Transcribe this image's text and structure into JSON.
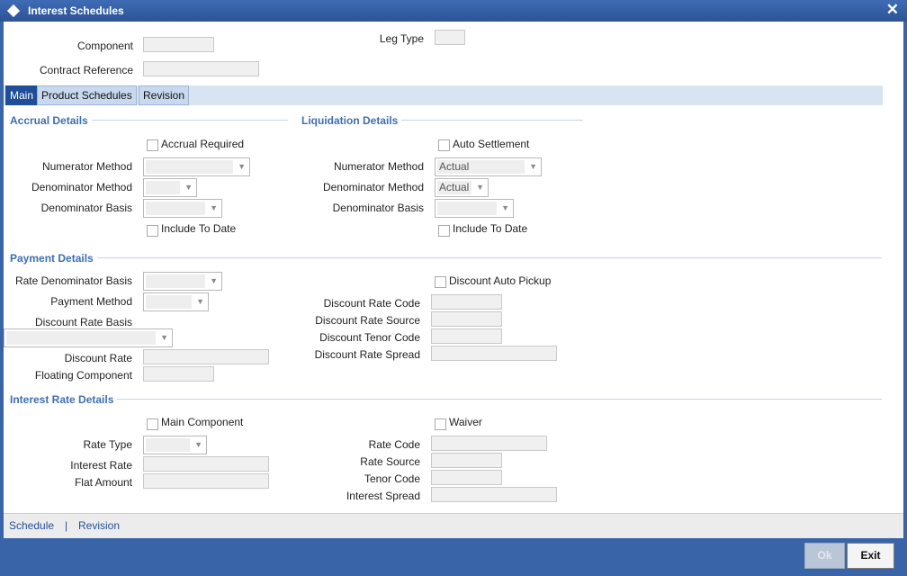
{
  "window": {
    "title": "Interest Schedules",
    "close_glyph": "✕"
  },
  "header": {
    "component_label": "Component",
    "component_value": "",
    "contract_reference_label": "Contract Reference",
    "contract_reference_value": "",
    "leg_type_label": "Leg Type",
    "leg_type_value": ""
  },
  "tabs": [
    {
      "label": "Main",
      "active": true
    },
    {
      "label": "Product Schedules",
      "active": false
    },
    {
      "label": "Revision",
      "active": false
    }
  ],
  "accrual": {
    "section_title": "Accrual Details",
    "accrual_required_label": "Accrual Required",
    "numerator_method_label": "Numerator Method",
    "numerator_method_value": "",
    "denominator_method_label": "Denominator Method",
    "denominator_method_value": "",
    "denominator_basis_label": "Denominator Basis",
    "denominator_basis_value": "",
    "include_to_date_label": "Include To Date"
  },
  "liquidation": {
    "section_title": "Liquidation Details",
    "auto_settlement_label": "Auto Settlement",
    "numerator_method_label": "Numerator Method",
    "numerator_method_value": "Actual",
    "denominator_method_label": "Denominator Method",
    "denominator_method_value": "Actual",
    "denominator_basis_label": "Denominator Basis",
    "denominator_basis_value": "",
    "include_to_date_label": "Include To Date"
  },
  "payment": {
    "section_title": "Payment Details",
    "rate_denominator_basis_label": "Rate Denominator Basis",
    "payment_method_label": "Payment Method",
    "discount_rate_basis_label": "Discount Rate Basis",
    "discount_rate_label": "Discount Rate",
    "floating_component_label": "Floating Component",
    "discount_auto_pickup_label": "Discount Auto Pickup",
    "discount_rate_code_label": "Discount Rate Code",
    "discount_rate_source_label": "Discount Rate Source",
    "discount_tenor_code_label": "Discount Tenor Code",
    "discount_rate_spread_label": "Discount Rate Spread"
  },
  "interest_rate": {
    "section_title": "Interest Rate Details",
    "main_component_label": "Main Component",
    "waiver_label": "Waiver",
    "rate_type_label": "Rate Type",
    "interest_rate_label": "Interest Rate",
    "flat_amount_label": "Flat Amount",
    "rate_code_label": "Rate Code",
    "rate_source_label": "Rate Source",
    "tenor_code_label": "Tenor Code",
    "interest_spread_label": "Interest Spread"
  },
  "bottom_links": {
    "schedule": "Schedule",
    "separator": "|",
    "revision": "Revision"
  },
  "buttons": {
    "ok": "Ok",
    "exit": "Exit"
  },
  "icons": {
    "title_icon": "diamond-icon",
    "close": "close-icon",
    "dropdown": "chevron-down-icon"
  }
}
